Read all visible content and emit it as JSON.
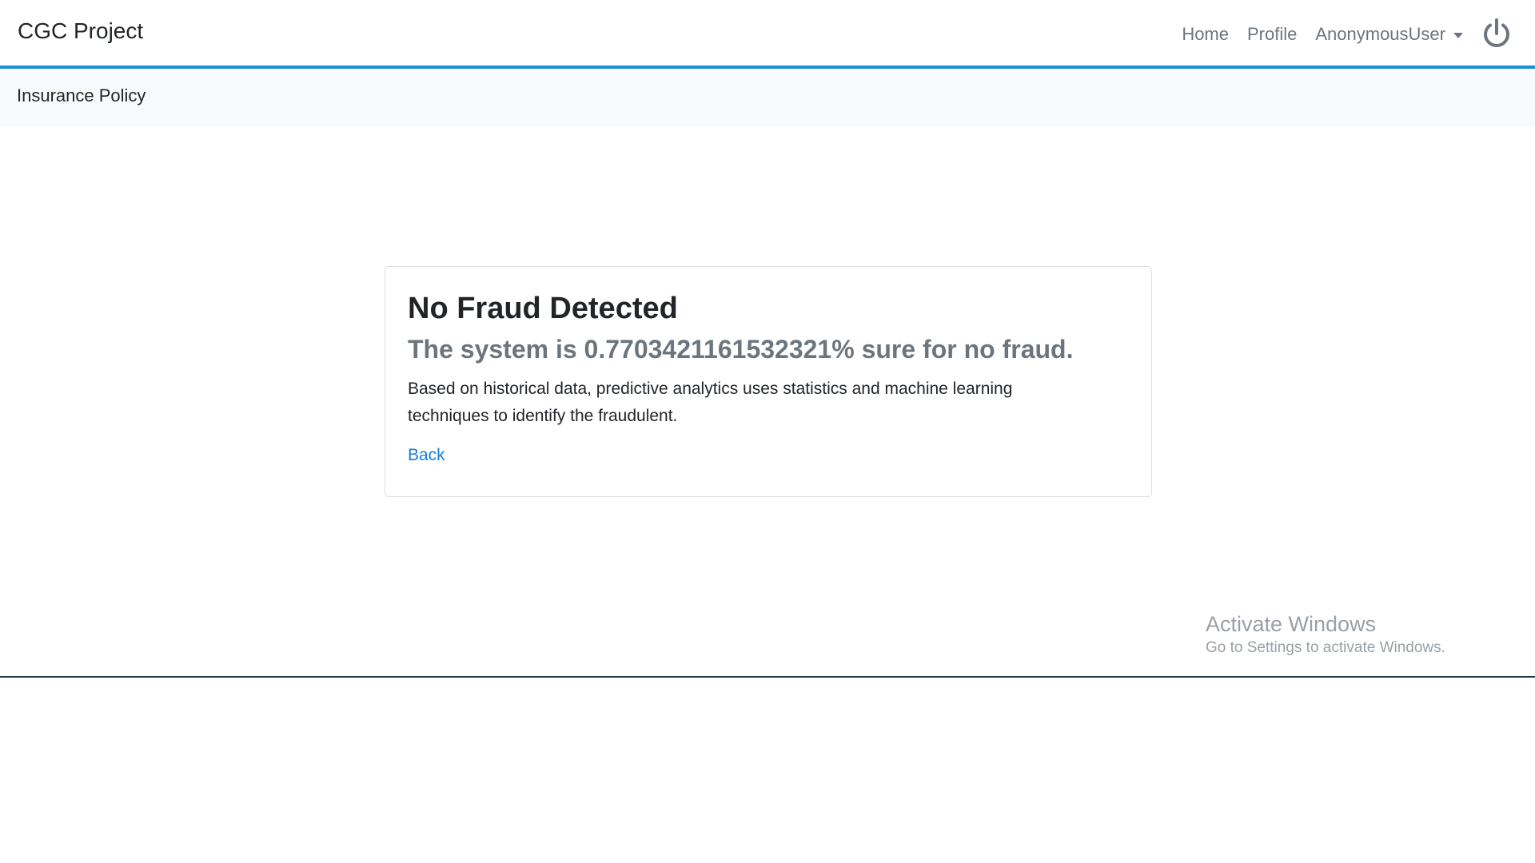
{
  "navbar": {
    "brand": "CGC Project",
    "links": {
      "home": "Home",
      "profile": "Profile",
      "user": "AnonymousUser"
    },
    "power_icon": "power-icon",
    "accent_color": "#1a8fd9"
  },
  "subbar": {
    "title": "Insurance Policy"
  },
  "result_card": {
    "title": "No Fraud Detected",
    "subtitle": "The system is 0.7703421161532321% sure for no fraud.",
    "description": "Based on historical data, predictive analytics uses statistics and machine learning techniques to identify the fraudulent.",
    "back_link": "Back"
  },
  "watermark": {
    "title": "Activate Windows",
    "subtitle": "Go to Settings to activate Windows."
  }
}
